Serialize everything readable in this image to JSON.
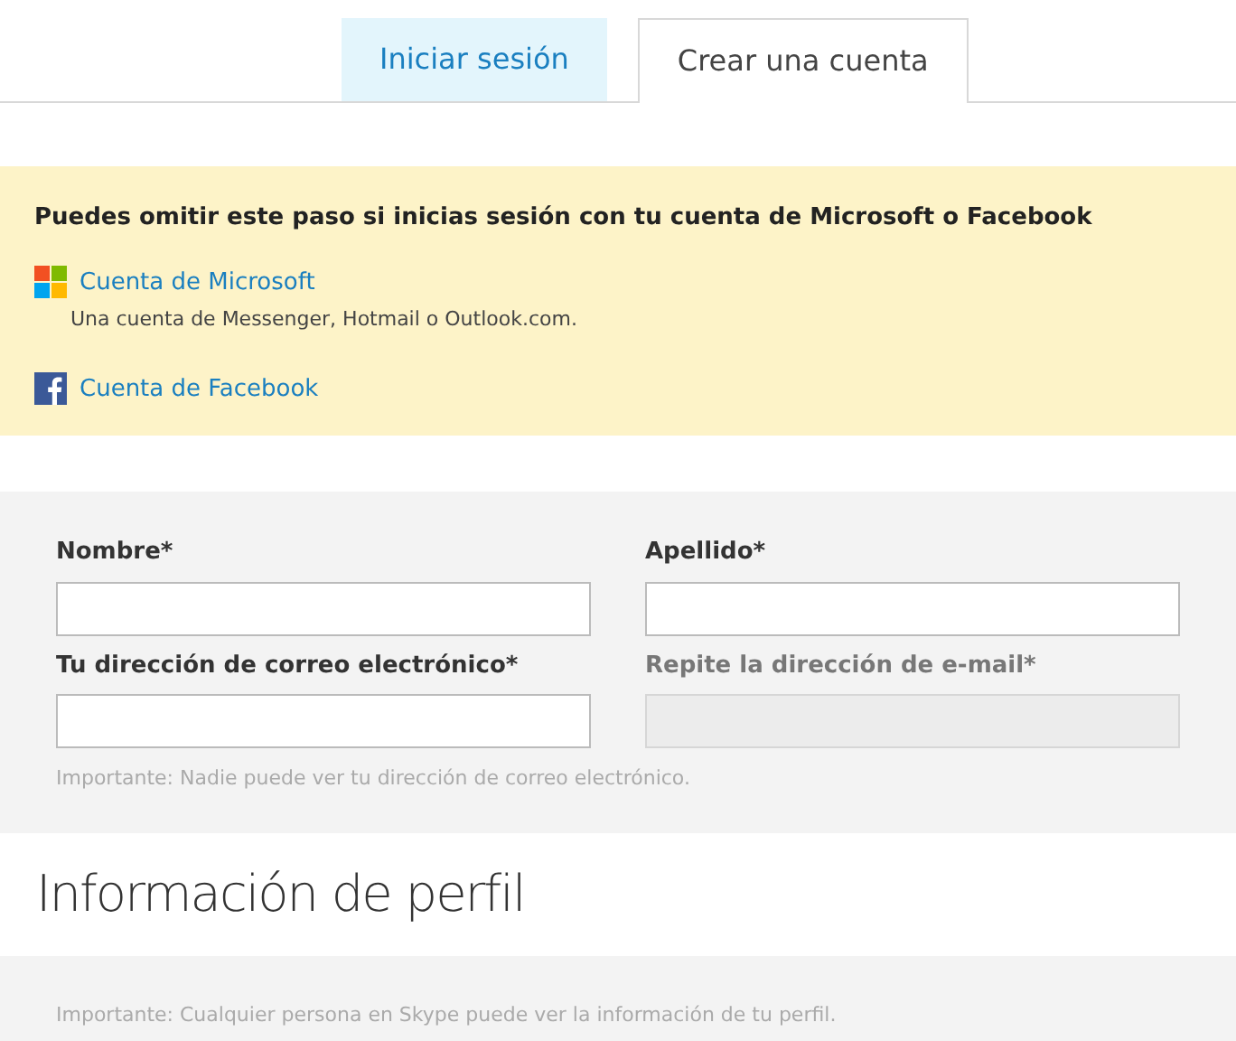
{
  "tabs": [
    {
      "label": "Iniciar sesión",
      "selected": false
    },
    {
      "label": "Crear una cuenta",
      "selected": true
    }
  ],
  "signin_options": {
    "heading": "Puedes omitir este paso si inicias sesión con tu cuenta de Microsoft o Facebook",
    "accounts": [
      {
        "kind": "microsoft",
        "label": "Cuenta de Microsoft",
        "description": "Una cuenta de Messenger, Hotmail o Outlook.com."
      },
      {
        "kind": "facebook",
        "label": "Cuenta de Facebook"
      }
    ]
  },
  "form": {
    "fields": [
      {
        "label": "Nombre*",
        "disabled": false
      },
      {
        "label": "Apellido*",
        "disabled": false
      },
      {
        "label": "Tu dirección de correo electrónico*",
        "disabled": false
      },
      {
        "label": "Repite la dirección de e-mail*",
        "disabled": true
      }
    ],
    "note": "Importante: Nadie puede ver tu dirección de correo electrónico."
  },
  "profile": {
    "heading": "Información de perfil",
    "note": "Importante: Cualquier persona en Skype puede ver la información de tu perfil."
  }
}
